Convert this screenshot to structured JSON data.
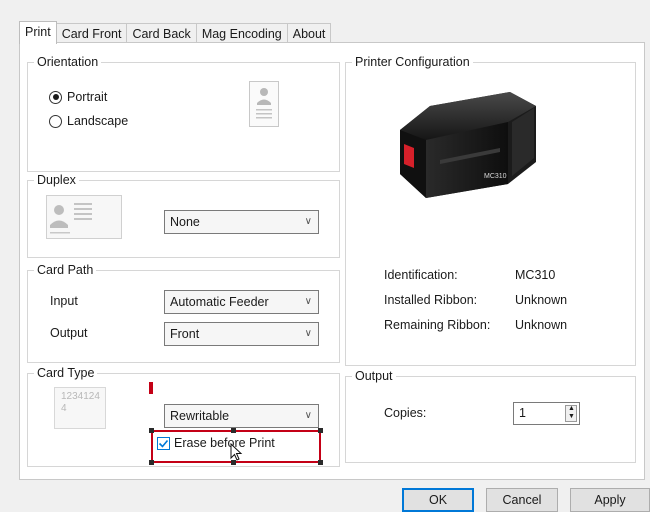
{
  "tabs": [
    "Print",
    "Card Front",
    "Card Back",
    "Mag Encoding",
    "About"
  ],
  "orientation": {
    "legend": "Orientation",
    "portrait_label": "Portrait",
    "landscape_label": "Landscape",
    "selected": "Portrait"
  },
  "duplex": {
    "legend": "Duplex",
    "value": "None"
  },
  "card_path": {
    "legend": "Card Path",
    "input_label": "Input",
    "input_value": "Automatic Feeder",
    "output_label": "Output",
    "output_value": "Front"
  },
  "card_type": {
    "legend": "Card Type",
    "card_number": "1234124",
    "card_number_cont": "4",
    "value": "Rewritable",
    "erase_label": "Erase before Print",
    "erase_checked": true
  },
  "printer_config": {
    "legend": "Printer Configuration",
    "printer_badge": "MC310",
    "identification_label": "Identification:",
    "identification_value": "MC310",
    "ribbon_label": "Installed Ribbon:",
    "ribbon_value": "Unknown",
    "remaining_label": "Remaining Ribbon:",
    "remaining_value": "Unknown"
  },
  "output": {
    "legend": "Output",
    "copies_label": "Copies:",
    "copies_value": "1"
  },
  "buttons": {
    "ok": "OK",
    "cancel": "Cancel",
    "apply": "Apply"
  },
  "colors": {
    "accent": "#0078d7",
    "annotation": "#c40016",
    "printer_red": "#d6202a"
  }
}
